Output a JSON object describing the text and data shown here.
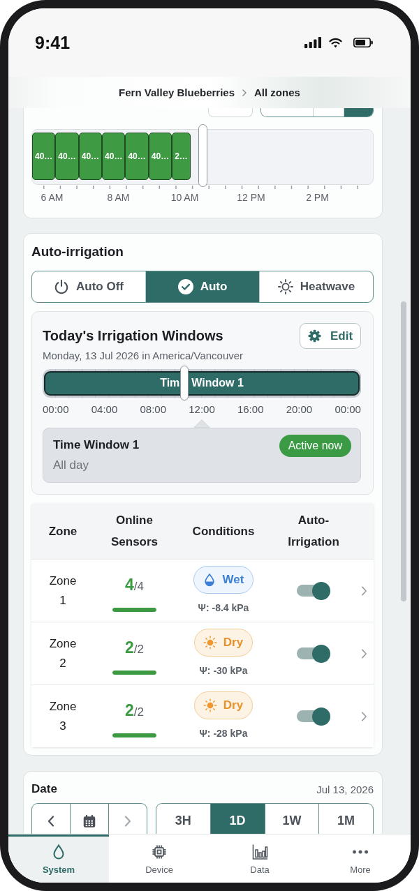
{
  "status_bar": {
    "time": "9:41"
  },
  "header": {
    "breadcrumb": [
      "Fern Valley Blueberries",
      "All zones"
    ]
  },
  "activity_card": {
    "clipped_segments": [
      {
        "selected": false
      },
      {
        "selected": false
      },
      {
        "selected": true
      }
    ],
    "timeline": {
      "blocks": [
        {
          "label": "40…"
        },
        {
          "label": "40…"
        },
        {
          "label": "40…"
        },
        {
          "label": "40…"
        },
        {
          "label": "40…"
        },
        {
          "label": "40…"
        },
        {
          "label": "2…"
        }
      ],
      "cursor": {
        "level": 0.5
      },
      "axis_labels": [
        "6 AM",
        "8 AM",
        "10 AM",
        "12 PM",
        "2 PM"
      ]
    }
  },
  "auto_irrigation": {
    "title": "Auto-irrigation",
    "modes": [
      {
        "kind": "off",
        "label": "Auto Off",
        "selected": false
      },
      {
        "kind": "auto",
        "label": "Auto",
        "selected": true
      },
      {
        "kind": "heatwave",
        "label": "Heatwave",
        "selected": false
      }
    ],
    "windows": {
      "title": "Today's Irrigation Windows",
      "edit_button": "Edit",
      "subtitle": "Monday, 13 Jul 2026 in America/Vancouver",
      "bar_label_before_handle": "Tim",
      "bar_label_after_handle": "Window 1",
      "axis_labels": [
        "00:00",
        "04:00",
        "08:00",
        "12:00",
        "16:00",
        "20:00",
        "00:00"
      ],
      "popover": {
        "title": "Time Window 1",
        "detail": "All day",
        "badge": "Active now"
      }
    },
    "table": {
      "columns": [
        "Zone",
        "Online Sensors",
        "Conditions",
        "Auto-Irrigation"
      ],
      "rows": [
        {
          "zone": "Zone 1",
          "sensors": {
            "count": "**4**/4",
            "level": 1
          },
          "condition": {
            "kind": "wet",
            "label": "Wet",
            "reading": "Ψ: -8.4 kPa"
          },
          "auto_irrigation": {
            "on": true
          }
        },
        {
          "zone": "Zone 2",
          "sensors": {
            "count": "**2**/2",
            "level": 1
          },
          "condition": {
            "kind": "dry",
            "label": "Dry",
            "reading": "Ψ: -30 kPa"
          },
          "auto_irrigation": {
            "on": true
          }
        },
        {
          "zone": "Zone 3",
          "sensors": {
            "count": "**2**/2",
            "level": 1
          },
          "condition": {
            "kind": "dry",
            "label": "Dry",
            "reading": "Ψ: -28 kPa"
          },
          "auto_irrigation": {
            "on": true
          }
        }
      ]
    }
  },
  "date_card": {
    "title": "Date",
    "date": "Jul 13, 2026",
    "nav_buttons": [
      {
        "kind": "previous",
        "disabled": false
      },
      {
        "kind": "calendar",
        "disabled": false
      },
      {
        "kind": "next",
        "disabled": true
      }
    ],
    "ranges": [
      {
        "label": "3H",
        "selected": false
      },
      {
        "label": "1D",
        "selected": true
      },
      {
        "label": "1W",
        "selected": false
      },
      {
        "label": "1M",
        "selected": false
      }
    ]
  },
  "tab_bar": {
    "tabs": [
      {
        "kind": "system",
        "label": "System",
        "selected": true
      },
      {
        "kind": "device",
        "label": "Device",
        "selected": false
      },
      {
        "kind": "data",
        "label": "Data",
        "selected": false
      },
      {
        "kind": "more",
        "label": "More",
        "selected": false
      }
    ]
  }
}
